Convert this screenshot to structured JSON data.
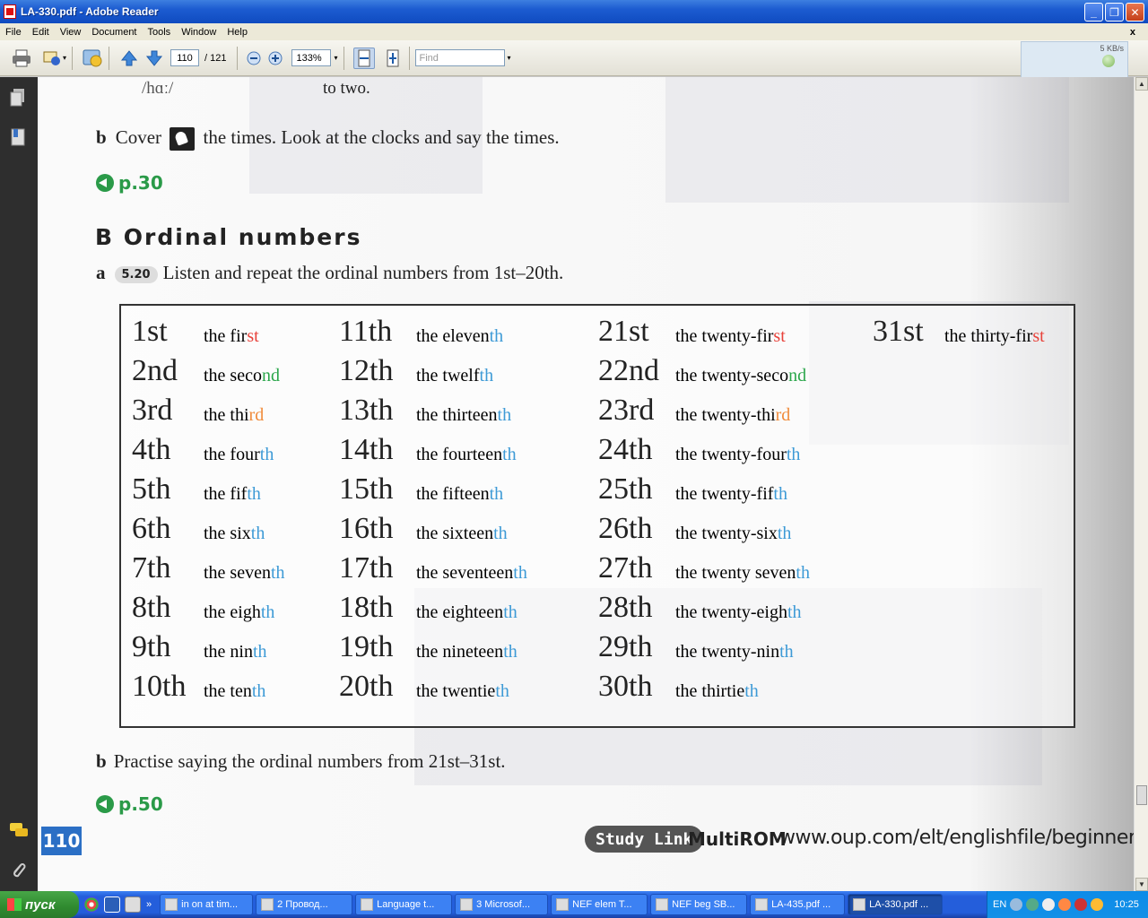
{
  "window": {
    "title": "LA-330.pdf - Adobe Reader",
    "min": "_",
    "max": "❐",
    "close": "✕"
  },
  "menu": [
    "File",
    "Edit",
    "View",
    "Document",
    "Tools",
    "Window",
    "Help"
  ],
  "menu_close": "x",
  "toolbar": {
    "page_current": "110",
    "page_total": "/ 121",
    "zoom": "133%",
    "find_placeholder": "Find",
    "net_speed": "5 KB/s"
  },
  "document": {
    "top_left_fragment": "/hɑː/",
    "top_right_fragment": "to two.",
    "b_cover": {
      "letter": "b",
      "before": "Cover",
      "after": "the times. Look at the clocks and say the times."
    },
    "link1": "p.30",
    "section_letter": "B",
    "section_title": "Ordinal numbers",
    "instr_a": {
      "letter": "a",
      "track": "5.20",
      "text": "Listen and repeat the ordinal numbers from 1st–20th."
    },
    "instr_b": {
      "letter": "b",
      "text": "Practise saying the ordinal numbers from 21st–31st."
    },
    "link2": "p.50",
    "page_number": "110",
    "studylink": "Study Link",
    "multirom": "MultiROM",
    "website": "www.oup.com/elt/englishfile/beginner"
  },
  "ordinals": {
    "col1": [
      {
        "n": "1",
        "s": "st",
        "w": "the fir",
        "ws": "st",
        "c": "red"
      },
      {
        "n": "2",
        "s": "nd",
        "w": "the seco",
        "ws": "nd",
        "c": "green"
      },
      {
        "n": "3",
        "s": "rd",
        "w": "the thi",
        "ws": "rd",
        "c": "orange"
      },
      {
        "n": "4",
        "s": "th",
        "w": "the four",
        "ws": "th",
        "c": "blue"
      },
      {
        "n": "5",
        "s": "th",
        "w": "the fif",
        "ws": "th",
        "c": "blue"
      },
      {
        "n": "6",
        "s": "th",
        "w": "the six",
        "ws": "th",
        "c": "blue"
      },
      {
        "n": "7",
        "s": "th",
        "w": "the seven",
        "ws": "th",
        "c": "blue"
      },
      {
        "n": "8",
        "s": "th",
        "w": "the eigh",
        "ws": "th",
        "c": "blue"
      },
      {
        "n": "9",
        "s": "th",
        "w": "the nin",
        "ws": "th",
        "c": "blue"
      },
      {
        "n": "10",
        "s": "th",
        "w": "the ten",
        "ws": "th",
        "c": "blue"
      }
    ],
    "col2": [
      {
        "n": "11",
        "s": "th",
        "w": "the eleven",
        "ws": "th",
        "c": "blue"
      },
      {
        "n": "12",
        "s": "th",
        "w": "the twelf",
        "ws": "th",
        "c": "blue"
      },
      {
        "n": "13",
        "s": "th",
        "w": "the thirteen",
        "ws": "th",
        "c": "blue"
      },
      {
        "n": "14",
        "s": "th",
        "w": "the fourteen",
        "ws": "th",
        "c": "blue"
      },
      {
        "n": "15",
        "s": "th",
        "w": "the fifteen",
        "ws": "th",
        "c": "blue"
      },
      {
        "n": "16",
        "s": "th",
        "w": "the sixteen",
        "ws": "th",
        "c": "blue"
      },
      {
        "n": "17",
        "s": "th",
        "w": "the seventeen",
        "ws": "th",
        "c": "blue"
      },
      {
        "n": "18",
        "s": "th",
        "w": "the eighteen",
        "ws": "th",
        "c": "blue"
      },
      {
        "n": "19",
        "s": "th",
        "w": "the nineteen",
        "ws": "th",
        "c": "blue"
      },
      {
        "n": "20",
        "s": "th",
        "w": "the twentie",
        "ws": "th",
        "c": "blue"
      }
    ],
    "col3": [
      {
        "n": "21",
        "s": "st",
        "w": "the twenty-fir",
        "ws": "st",
        "c": "red"
      },
      {
        "n": "22",
        "s": "nd",
        "w": "the twenty-seco",
        "ws": "nd",
        "c": "green"
      },
      {
        "n": "23",
        "s": "rd",
        "w": "the twenty-thi",
        "ws": "rd",
        "c": "orange"
      },
      {
        "n": "24",
        "s": "th",
        "w": "the twenty-four",
        "ws": "th",
        "c": "blue"
      },
      {
        "n": "25",
        "s": "th",
        "w": "the twenty-fif",
        "ws": "th",
        "c": "blue"
      },
      {
        "n": "26",
        "s": "th",
        "w": "the twenty-six",
        "ws": "th",
        "c": "blue"
      },
      {
        "n": "27",
        "s": "th",
        "w": "the twenty seven",
        "ws": "th",
        "c": "blue"
      },
      {
        "n": "28",
        "s": "th",
        "w": "the twenty-eigh",
        "ws": "th",
        "c": "blue"
      },
      {
        "n": "29",
        "s": "th",
        "w": "the twenty-nin",
        "ws": "th",
        "c": "blue"
      },
      {
        "n": "30",
        "s": "th",
        "w": "the thirtie",
        "ws": "th",
        "c": "blue"
      }
    ],
    "col4": [
      {
        "n": "31",
        "s": "st",
        "w": "the thirty-fir",
        "ws": "st",
        "c": "red"
      }
    ]
  },
  "taskbar": {
    "start": "пуск",
    "items": [
      {
        "label": "in on at tim...",
        "active": false
      },
      {
        "label": "2 Провод...",
        "active": false
      },
      {
        "label": "Language t...",
        "active": false
      },
      {
        "label": "3 Microsof...",
        "active": false
      },
      {
        "label": "NEF elem T...",
        "active": false
      },
      {
        "label": "NEF beg SB...",
        "active": false
      },
      {
        "label": "LA-435.pdf ...",
        "active": false
      },
      {
        "label": "LA-330.pdf ...",
        "active": true
      }
    ],
    "lang": "EN",
    "clock": "10:25"
  },
  "colors": {
    "red": "#e8413a",
    "green": "#2aa64a",
    "orange": "#f08b3a",
    "blue": "#3d9ad6",
    "link_green": "#2a9a48"
  }
}
